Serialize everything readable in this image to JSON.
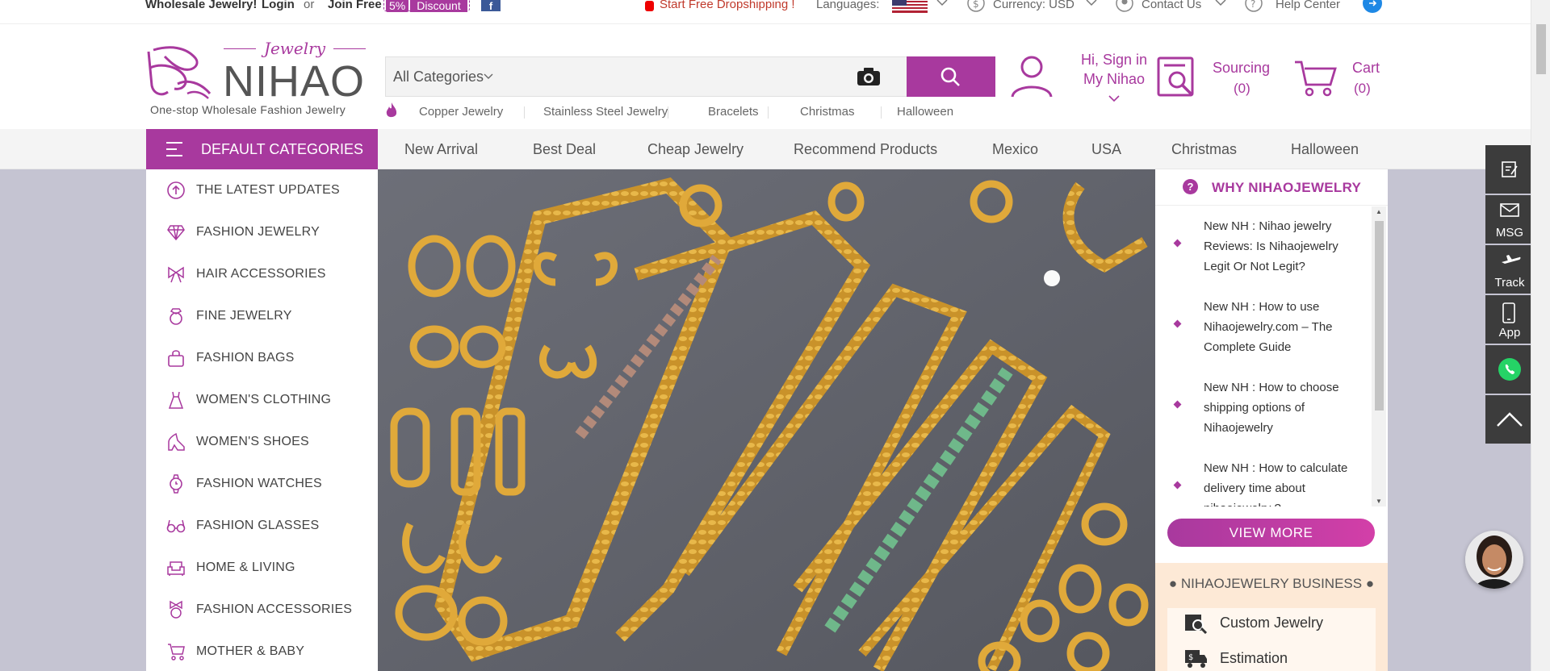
{
  "topbar": {
    "wholesale": "Wholesale Jewelry!",
    "login": "Login",
    "or": "or",
    "join": "Join Free",
    "discount_pct": "5%",
    "discount_label": "Discount",
    "dropship": "Start Free Dropshipping !",
    "languages": "Languages:",
    "currency": "Currency: USD",
    "contact": "Contact Us",
    "help": "Help Center"
  },
  "logo": {
    "script": "Jewelry",
    "name": "NIHAO",
    "tagline": "One-stop Wholesale Fashion Jewelry"
  },
  "search": {
    "category": "All Categories",
    "placeholder": ""
  },
  "hot_links": [
    "Copper Jewelry",
    "Stainless Steel Jewelry",
    "Bracelets",
    "Christmas",
    "Halloween"
  ],
  "account": {
    "line1": "Hi, Sign in",
    "line2": "My Nihao"
  },
  "sourcing": {
    "label": "Sourcing",
    "count": "(0)"
  },
  "cart": {
    "label": "Cart",
    "count": "(0)"
  },
  "nav": {
    "default_categories": "DEFAULT CATEGORIES",
    "items": [
      "New Arrival",
      "Best Deal",
      "Cheap Jewelry",
      "Recommend Products",
      "Mexico",
      "USA",
      "Christmas",
      "Halloween"
    ]
  },
  "categories": [
    "THE LATEST UPDATES",
    "FASHION JEWELRY",
    "HAIR ACCESSORIES",
    "FINE JEWELRY",
    "FASHION BAGS",
    "WOMEN'S CLOTHING",
    "WOMEN'S SHOES",
    "FASHION WATCHES",
    "FASHION GLASSES",
    "HOME & LIVING",
    "FASHION ACCESSORIES",
    "MOTHER & BABY"
  ],
  "why": {
    "title": "WHY NIHAOJEWELRY",
    "items": [
      "New NH : Nihao jewelry Reviews: Is Nihaojewelry Legit Or Not Legit?",
      "New NH : How to use Nihaojewelry.com – The Complete Guide",
      "New NH : How to choose shipping options of Nihaojewelry",
      "New NH : How to calculate delivery time about nihaojewelry ?"
    ],
    "view_more": "VIEW MORE"
  },
  "business": {
    "title": "● NIHAOJEWELRY BUSINESS ●",
    "items": [
      "Custom Jewelry",
      "Estimation"
    ]
  },
  "side_tools": [
    "MSG",
    "Track",
    "App"
  ],
  "colors": {
    "brand": "#a8399e",
    "tool_bg": "#3c3c3c",
    "business_bg": "#fde9d6"
  }
}
